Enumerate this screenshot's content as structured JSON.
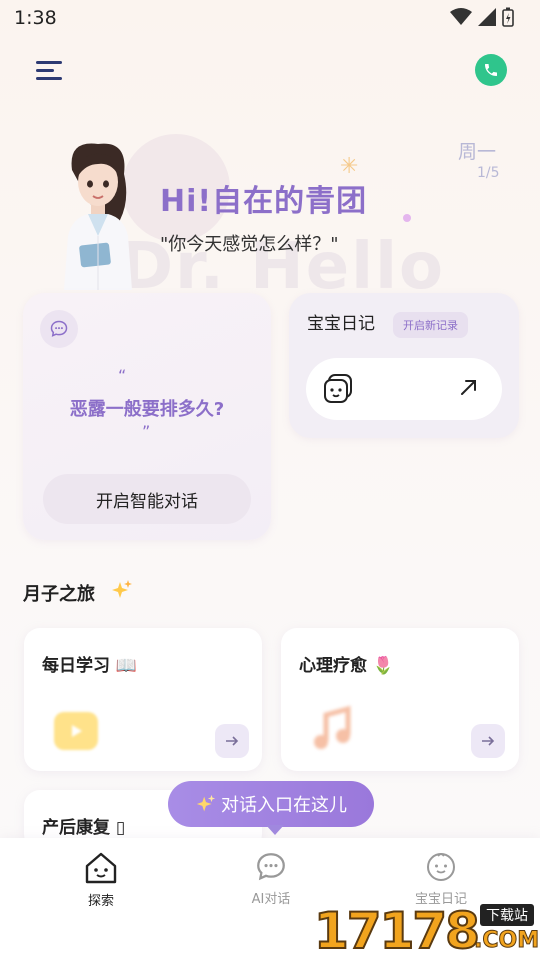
{
  "status_bar": {
    "time": "1:38"
  },
  "header": {
    "menu_icon": "menu-icon",
    "phone_icon": "phone-icon",
    "greeting": "Hi!自在的青团",
    "greeting_sub": "\"你今天感觉怎么样？\"",
    "weekday": "周一",
    "page_indicator": "1/5",
    "background_text": "Dr. Hello"
  },
  "chat_card": {
    "quote_open": "“",
    "question": "恶露一般要排多久?",
    "quote_close": "”",
    "button_label": "开启智能对话"
  },
  "diary_card": {
    "title": "宝宝日记",
    "badge": "开启新记录"
  },
  "journey": {
    "title": "月子之旅",
    "cards": [
      {
        "title": "每日学习 📖"
      },
      {
        "title": "心理疗愈 🌷"
      },
      {
        "title": "产后康复 ▯"
      }
    ]
  },
  "tooltip": {
    "text": "对话入口在这儿"
  },
  "bottom_nav": {
    "items": [
      {
        "label": "探索",
        "icon": "home-face-icon"
      },
      {
        "label": "AI对话",
        "icon": "chat-bubble-icon"
      },
      {
        "label": "宝宝日记",
        "icon": "baby-face-icon"
      }
    ]
  },
  "watermark": {
    "text": "17178",
    "tag": "下载站",
    "suffix": ".COM"
  },
  "colors": {
    "accent_purple": "#8c6fc9",
    "phone_green": "#2fc58c",
    "menu_navy": "#2d3a73"
  }
}
